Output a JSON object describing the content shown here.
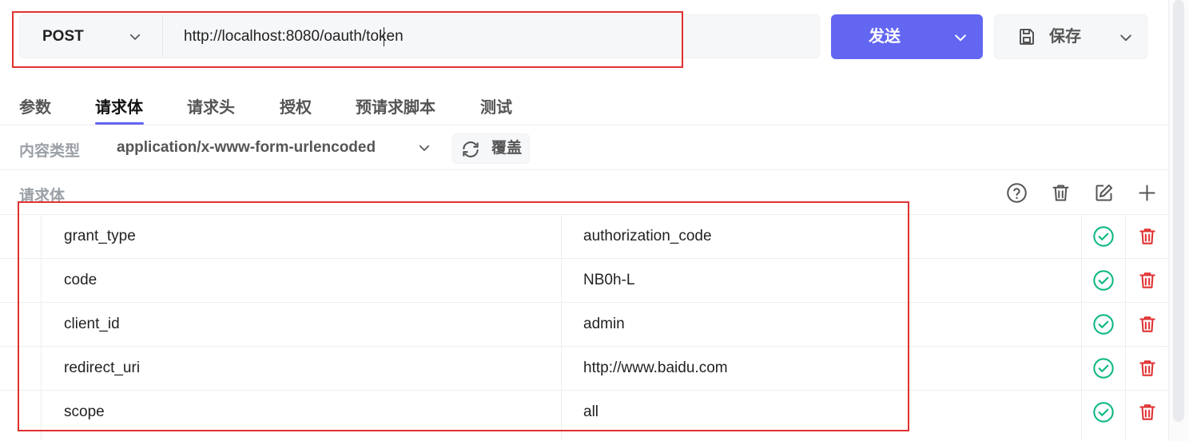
{
  "request": {
    "method": "POST",
    "url": "http://localhost:8080/oauth/token",
    "send_label": "发送",
    "save_label": "保存"
  },
  "tabs": [
    {
      "label": "参数",
      "active": false
    },
    {
      "label": "请求体",
      "active": true
    },
    {
      "label": "请求头",
      "active": false
    },
    {
      "label": "授权",
      "active": false
    },
    {
      "label": "预请求脚本",
      "active": false
    },
    {
      "label": "测试",
      "active": false
    }
  ],
  "content_type": {
    "label": "内容类型",
    "value": "application/x-www-form-urlencoded",
    "override_label": "覆盖"
  },
  "body": {
    "title": "请求体",
    "params": [
      {
        "key": "grant_type",
        "value": "authorization_code"
      },
      {
        "key": "code",
        "value": "NB0h-L"
      },
      {
        "key": "client_id",
        "value": "admin"
      },
      {
        "key": "redirect_uri",
        "value": "http://www.baidu.com"
      },
      {
        "key": "scope",
        "value": "all"
      }
    ]
  },
  "colors": {
    "accent": "#6366f1",
    "check": "#12b886",
    "delete": "#e03131",
    "highlight": "#e03131"
  },
  "icons": [
    "chevron-down-icon",
    "save-icon",
    "refresh-icon",
    "help-icon",
    "trash-icon",
    "edit-icon",
    "plus-icon",
    "check-circle-icon"
  ]
}
